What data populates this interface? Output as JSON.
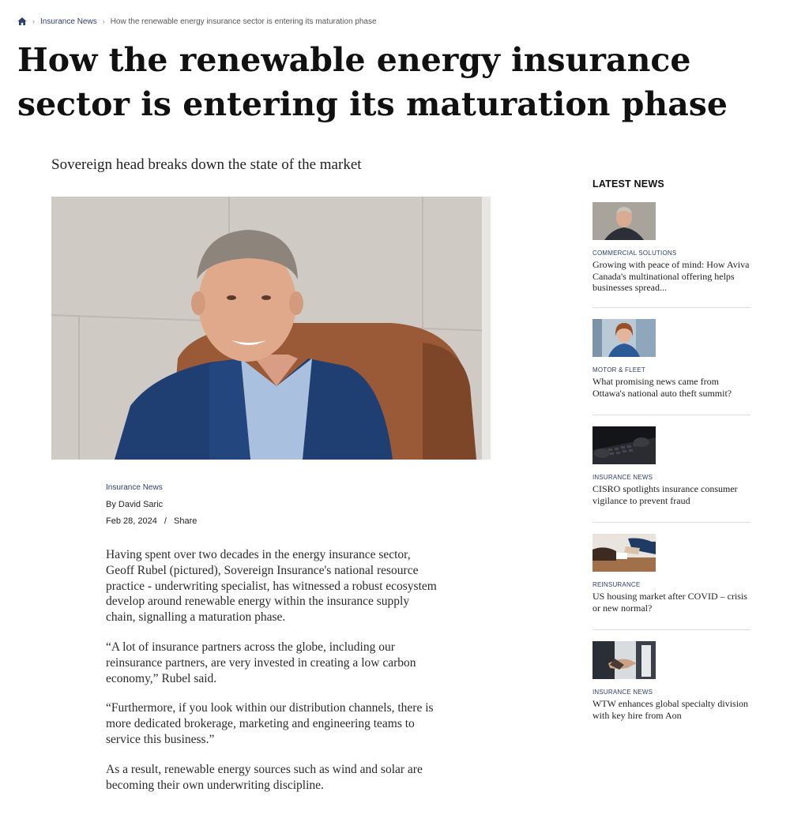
{
  "breadcrumb": {
    "home_icon": "home-icon",
    "section": "Insurance News",
    "current": "How the renewable energy insurance sector is entering its maturation phase"
  },
  "article": {
    "title": "How the renewable energy insurance sector is entering its maturation phase",
    "subtitle": "Sovereign head breaks down the state of the market",
    "category": "Insurance News",
    "author": "By David Saric",
    "date": "Feb 28, 2024",
    "separator": "/",
    "share_label": "Share",
    "paragraphs": [
      "Having spent over two decades in the energy insurance sector, Geoff Rubel (pictured), Sovereign Insurance's national resource practice - underwriting specialist, has witnessed a robust ecosystem develop around renewable energy within the insurance supply chain, signalling a maturation phase.",
      "“A lot of insurance partners across the globe, including our reinsurance partners, are very invested in creating a low carbon economy,” Rubel said.",
      "“Furthermore, if you look within our distribution channels, there is more dedicated brokerage, marketing and engineering teams to service this business.”",
      "As a result, renewable energy sources such as wind and solar are becoming their own underwriting discipline."
    ]
  },
  "sidebar": {
    "heading": "LATEST NEWS",
    "items": [
      {
        "category": "COMMERCIAL SOLUTIONS",
        "title": "Growing with peace of mind: How Aviva Canada's multinational offering helps businesses spread...",
        "thumb": "man-portrait"
      },
      {
        "category": "MOTOR & FLEET",
        "title": "What promising news came from Ottawa's national auto theft summit?",
        "thumb": "woman-portrait"
      },
      {
        "category": "INSURANCE NEWS",
        "title": "CISRO spotlights insurance consumer vigilance to prevent fraud",
        "thumb": "hacker-keyboard"
      },
      {
        "category": "REINSURANCE",
        "title": "US housing market after COVID – crisis or new normal?",
        "thumb": "house-keys-handover"
      },
      {
        "category": "INSURANCE NEWS",
        "title": "WTW enhances global specialty division with key hire from Aon",
        "thumb": "handshake"
      }
    ]
  },
  "colors": {
    "link_blue": "#2b3f6b",
    "title": "#111111",
    "body_text": "#2a2a2a",
    "divider": "#dcdcdc"
  }
}
